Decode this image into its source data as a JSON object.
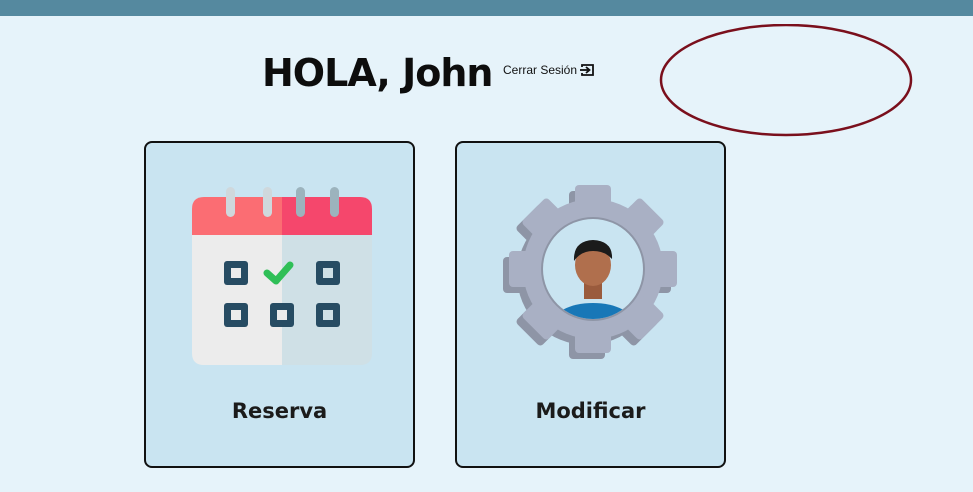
{
  "header": {
    "greeting": "HOLA, John",
    "logout_label": "Cerrar Sesión"
  },
  "cards": [
    {
      "label": "Reserva",
      "icon": "calendar-icon"
    },
    {
      "label": "Modificar",
      "icon": "user-settings-icon"
    }
  ],
  "colors": {
    "topbar": "#55899f",
    "background": "#e6f3fa",
    "card": "#c9e4f1",
    "annotation": "#7a0f1c"
  }
}
